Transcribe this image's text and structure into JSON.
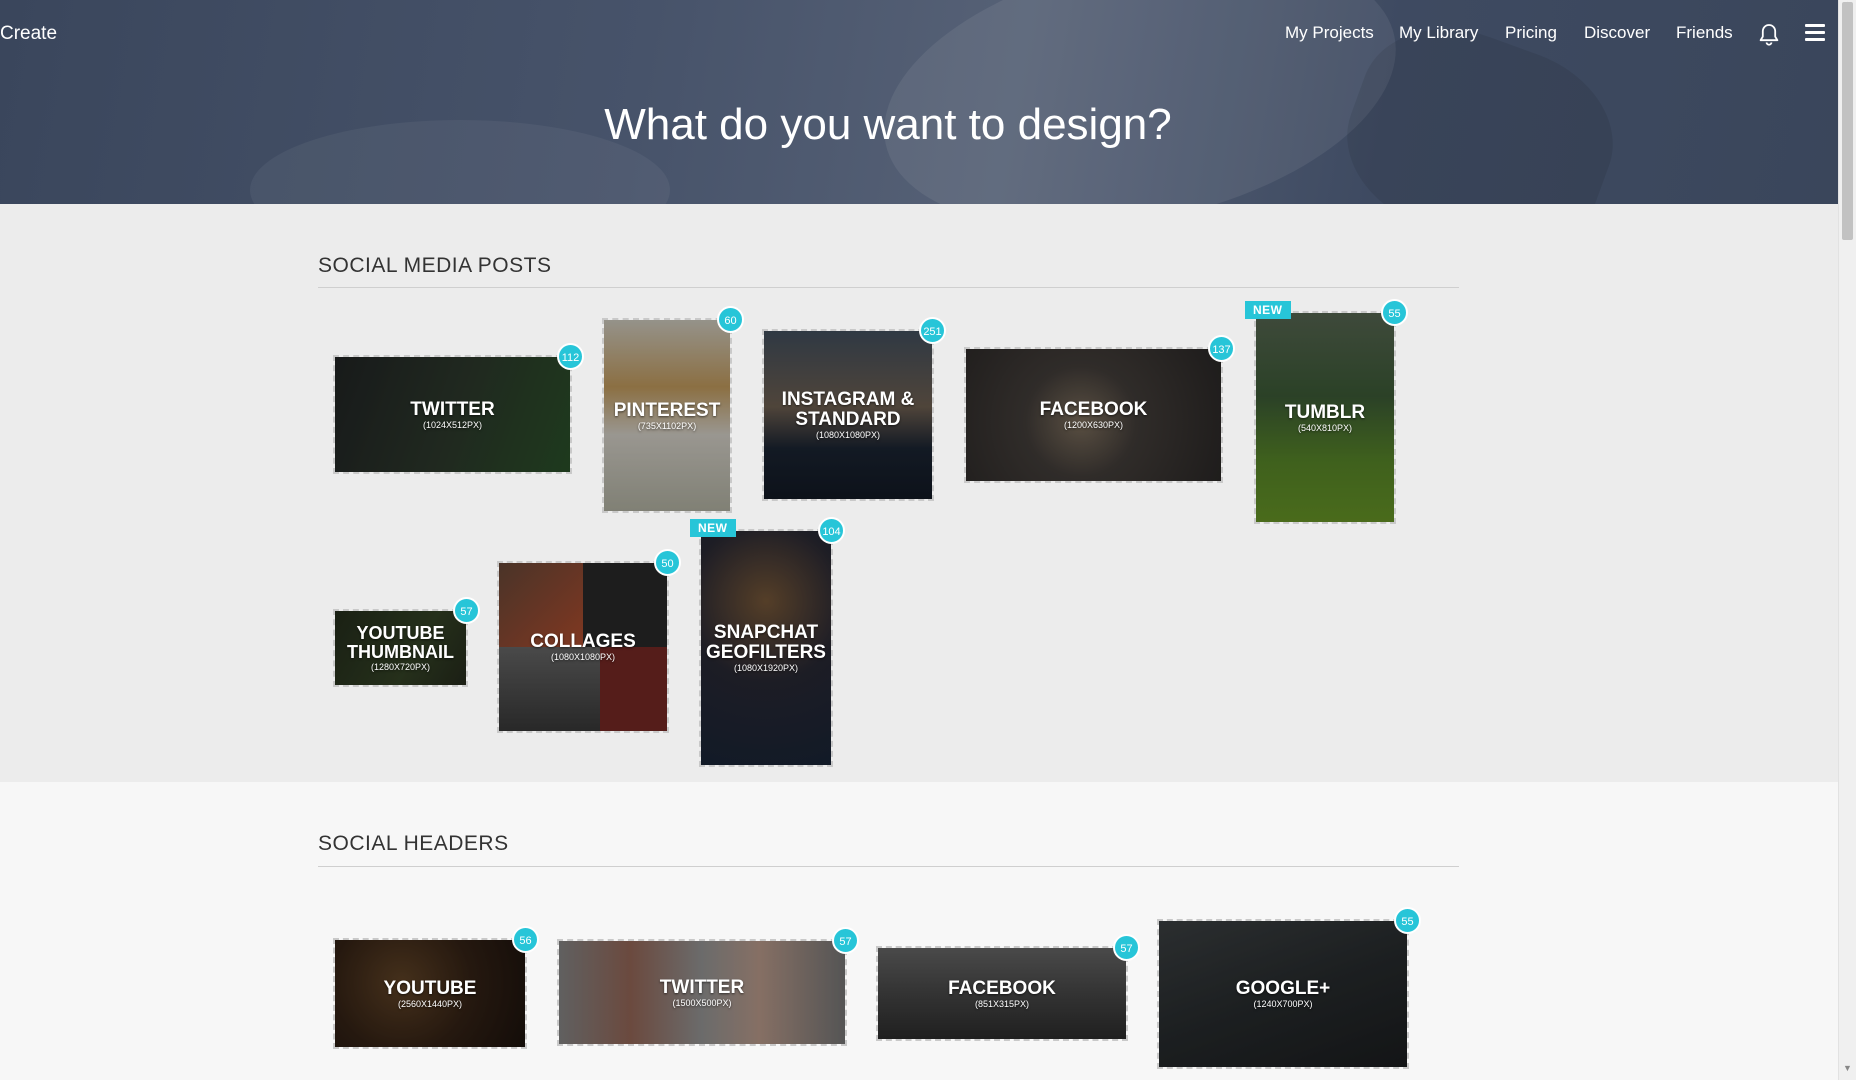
{
  "header": {
    "app_title": "Create",
    "nav": [
      "My Projects",
      "My Library",
      "Pricing",
      "Discover",
      "Friends"
    ],
    "hero_title": "What do you want to design?"
  },
  "sections": [
    {
      "title": "SOCIAL MEDIA POSTS",
      "cards": [
        {
          "name": "TWITTER",
          "dims": "(1024X512PX)",
          "count": "112",
          "bg": "#3c4a3a"
        },
        {
          "name": "PINTEREST",
          "dims": "(735X1102PX)",
          "count": "60",
          "bg": "#b9b4a8"
        },
        {
          "name": "INSTAGRAM & STANDARD",
          "dims": "(1080X1080PX)",
          "count": "251",
          "bg": "#2c3647"
        },
        {
          "name": "FACEBOOK",
          "dims": "(1200X630PX)",
          "count": "137",
          "bg": "#3e3b3a"
        },
        {
          "name": "TUMBLR",
          "dims": "(540X810PX)",
          "count": "55",
          "bg": "#4a6a30",
          "new": "NEW"
        },
        {
          "name": "YOUTUBE THUMBNAIL",
          "dims": "(1280X720PX)",
          "count": "57",
          "bg": "#2e3a28"
        },
        {
          "name": "COLLAGES",
          "dims": "(1080X1080PX)",
          "count": "50",
          "bg": "#4b4642"
        },
        {
          "name": "SNAPCHAT GEOFILTERS",
          "dims": "(1080X1920PX)",
          "count": "104",
          "bg": "#1f2a3a",
          "new": "NEW"
        }
      ]
    },
    {
      "title": "SOCIAL HEADERS",
      "cards": [
        {
          "name": "YOUTUBE",
          "dims": "(2560X1440PX)",
          "count": "56",
          "bg": "#3a2618"
        },
        {
          "name": "TWITTER",
          "dims": "(1500X500PX)",
          "count": "57",
          "bg": "#8a8a8a"
        },
        {
          "name": "FACEBOOK",
          "dims": "(851X315PX)",
          "count": "57",
          "bg": "#4a4a4a"
        },
        {
          "name": "GOOGLE+",
          "dims": "(1240X700PX)",
          "count": "55",
          "bg": "#262a2c"
        }
      ]
    }
  ],
  "colors": {
    "accent": "#27c5d8",
    "hero": "#3a465c"
  }
}
